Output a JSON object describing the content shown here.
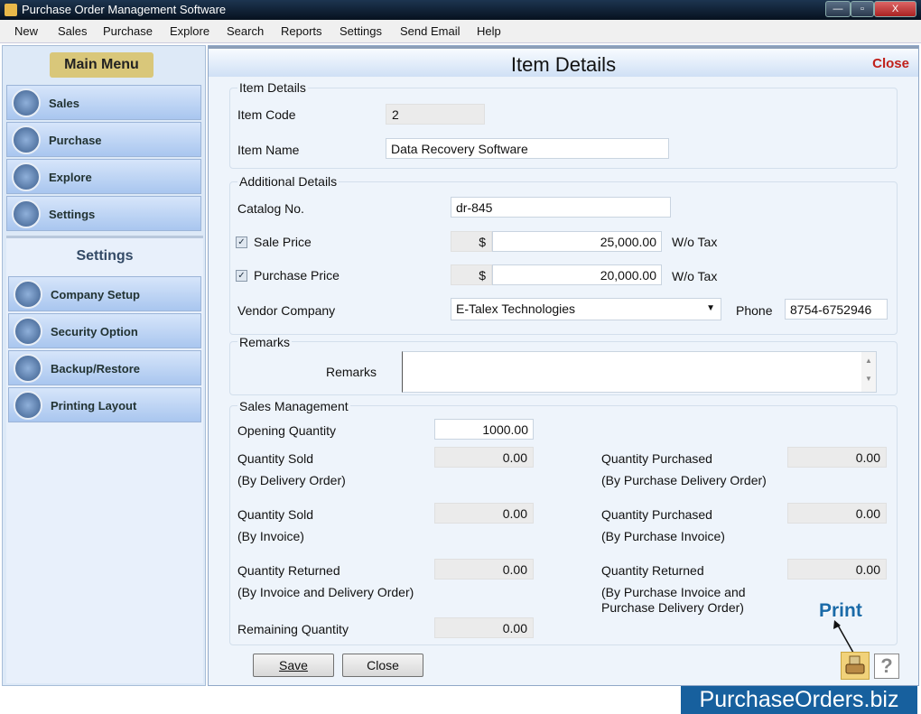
{
  "window": {
    "title": "Purchase Order Management Software",
    "minimize": "—",
    "restore": "▫",
    "close": "X"
  },
  "menu": [
    "New",
    "Sales",
    "Purchase",
    "Explore",
    "Search",
    "Reports",
    "Settings",
    "Send Email",
    "Help"
  ],
  "sidebar": {
    "main_title": "Main Menu",
    "main_items": [
      "Sales",
      "Purchase",
      "Explore",
      "Settings"
    ],
    "settings_title": "Settings",
    "settings_items": [
      "Company Setup",
      "Security Option",
      "Backup/Restore",
      "Printing Layout"
    ]
  },
  "header": {
    "title": "Item Details",
    "close": "Close"
  },
  "item_details": {
    "legend": "Item Details",
    "code_label": "Item Code",
    "code": "2",
    "name_label": "Item Name",
    "name": "Data Recovery Software"
  },
  "additional": {
    "legend": "Additional Details",
    "catalog_label": "Catalog No.",
    "catalog": "dr-845",
    "sale_label": "Sale Price",
    "sale_currency": "$",
    "sale": "25,000.00",
    "sale_tax": "W/o Tax",
    "purchase_label": "Purchase Price",
    "purchase_currency": "$",
    "purchase": "20,000.00",
    "purchase_tax": "W/o Tax",
    "vendor_label": "Vendor Company",
    "vendor": "E-Talex Technologies",
    "phone_label": "Phone",
    "phone": "8754-6752946"
  },
  "remarks": {
    "legend": "Remarks",
    "label": "Remarks",
    "value": ""
  },
  "sales_mgmt": {
    "legend": "Sales Management",
    "opening_label": "Opening Quantity",
    "opening": "1000.00",
    "sold_do_label": "Quantity Sold",
    "sold_do_sub": "(By Delivery Order)",
    "sold_do": "0.00",
    "sold_inv_label": "Quantity Sold",
    "sold_inv_sub": "(By Invoice)",
    "sold_inv": "0.00",
    "ret_label": "Quantity Returned",
    "ret_sub": "(By Invoice and Delivery Order)",
    "ret": "0.00",
    "remaining_label": "Remaining Quantity",
    "remaining": "0.00",
    "pur_pdo_label": "Quantity Purchased",
    "pur_pdo_sub": "(By Purchase Delivery Order)",
    "pur_pdo": "0.00",
    "pur_inv_label": "Quantity Purchased",
    "pur_inv_sub": "(By Purchase Invoice)",
    "pur_inv": "0.00",
    "pret_label": "Quantity Returned",
    "pret_sub1": "(By Purchase Invoice and",
    "pret_sub2": "Purchase Delivery Order)",
    "pret": "0.00"
  },
  "buttons": {
    "save": "Save",
    "close": "Close",
    "help": "?"
  },
  "annotation": {
    "print": "Print"
  },
  "brand": "PurchaseOrders.biz"
}
